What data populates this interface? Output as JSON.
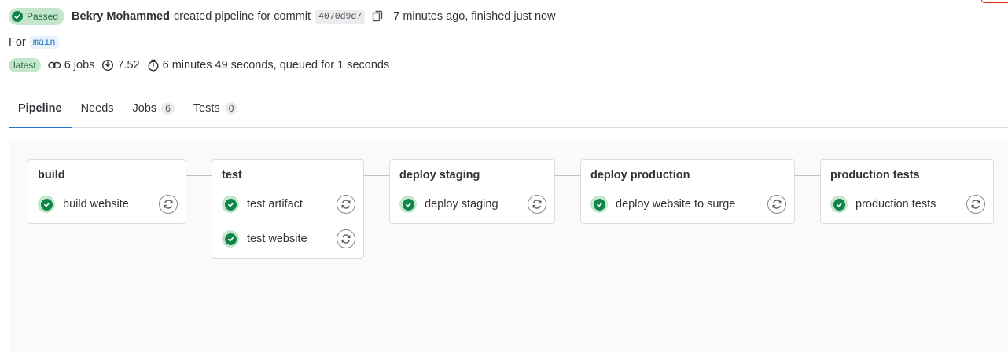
{
  "header": {
    "status_label": "Passed",
    "author": "Bekry Mohammed",
    "action_text": "created pipeline for commit",
    "commit_sha": "4070d9d7",
    "time_text": "7 minutes ago, finished just now",
    "for_label": "For",
    "ref": "main",
    "latest_badge": "latest",
    "jobs_count": "6 jobs",
    "compute": "7.52",
    "duration": "6 minutes 49 seconds, queued for 1 seconds"
  },
  "tabs": [
    {
      "label": "Pipeline",
      "count": null,
      "active": true
    },
    {
      "label": "Needs",
      "count": null,
      "active": false
    },
    {
      "label": "Jobs",
      "count": "6",
      "active": false
    },
    {
      "label": "Tests",
      "count": "0",
      "active": false
    }
  ],
  "stages": [
    {
      "title": "build",
      "jobs": [
        {
          "name": "build website",
          "status": "passed"
        }
      ]
    },
    {
      "title": "test",
      "jobs": [
        {
          "name": "test artifact",
          "status": "passed"
        },
        {
          "name": "test website",
          "status": "passed"
        }
      ]
    },
    {
      "title": "deploy staging",
      "jobs": [
        {
          "name": "deploy staging",
          "status": "passed"
        }
      ]
    },
    {
      "title": "deploy production",
      "jobs": [
        {
          "name": "deploy website to surge",
          "status": "passed"
        }
      ]
    },
    {
      "title": "production tests",
      "jobs": [
        {
          "name": "production tests",
          "status": "passed"
        }
      ]
    }
  ],
  "colors": {
    "success": "#108548",
    "success_bg": "#c3e6cd",
    "accent": "#1f75cb"
  },
  "icons": {
    "status": "check-circle-icon",
    "copy": "copy-icon",
    "jobs": "link-icon",
    "compute": "compute-icon",
    "duration": "timer-icon",
    "retry": "retry-icon"
  }
}
